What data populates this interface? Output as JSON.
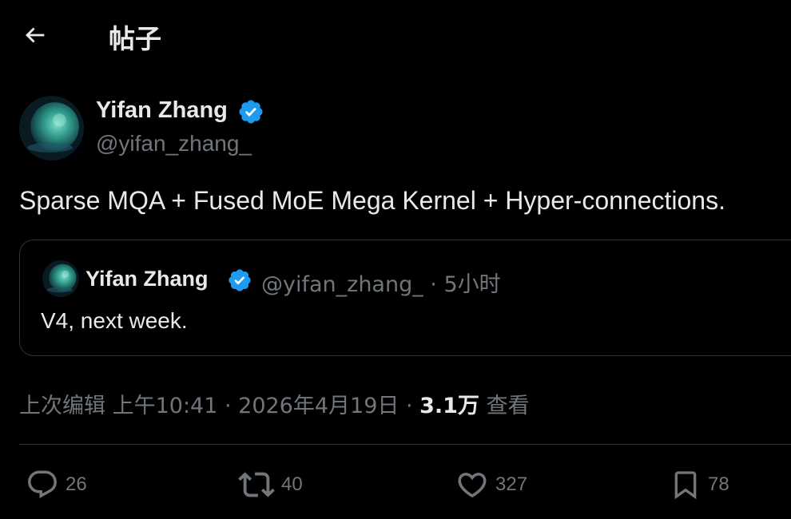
{
  "header": {
    "title": "帖子",
    "back_icon": "arrow-left-icon"
  },
  "author": {
    "name": "Yifan Zhang",
    "handle": "@yifan_zhang_",
    "verified": true,
    "verified_color": "#1d9bf0"
  },
  "tweet": {
    "text": "Sparse MQA + Fused MoE Mega Kernel + Hyper-connections."
  },
  "quote": {
    "name": "Yifan Zhang",
    "meta": "@yifan_zhang_ · 5小时",
    "text": "V4, next week."
  },
  "meta": {
    "edited_time": "上次编辑 上午10:41 · 2026年4月19日 · ",
    "views_count": "3.1万",
    "views_label": " 查看"
  },
  "actions": {
    "replies": "26",
    "retweets": "40",
    "likes": "327",
    "bookmarks": "78"
  },
  "colors": {
    "background": "#000000",
    "text": "#e7e9ea",
    "secondary": "#71767b",
    "border": "#2f3336"
  }
}
